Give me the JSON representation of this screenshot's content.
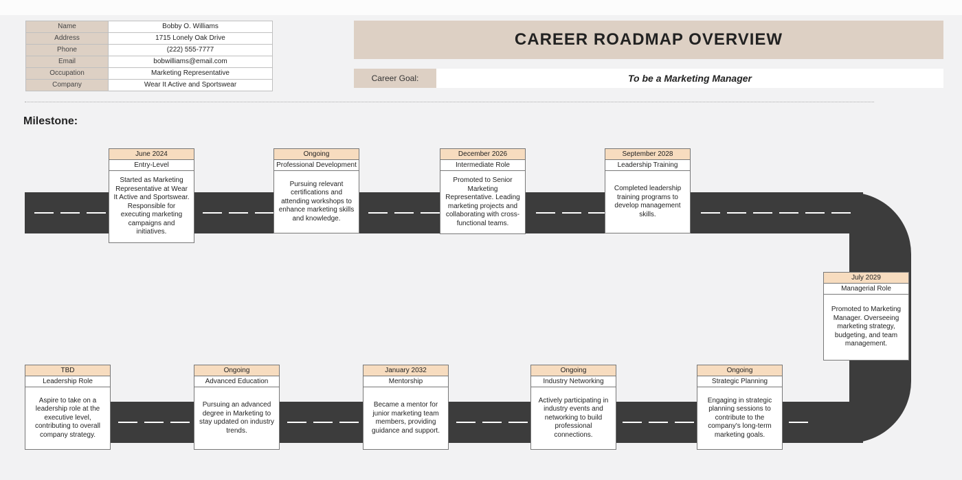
{
  "info": {
    "name_label": "Name",
    "name": "Bobby O. Williams",
    "address_label": "Address",
    "address": "1715 Lonely Oak Drive",
    "phone_label": "Phone",
    "phone": "(222) 555-7777",
    "email_label": "Email",
    "email": "bobwilliams@email.com",
    "occupation_label": "Occupation",
    "occupation": "Marketing Representative",
    "company_label": "Company",
    "company": "Wear It Active and Sportswear"
  },
  "title": "CAREER ROADMAP OVERVIEW",
  "goal_label": "Career Goal:",
  "goal_value": "To be a Marketing Manager",
  "milestone_header": "Milestone:",
  "milestones_top": [
    {
      "date": "June 2024",
      "cat": "Entry-Level",
      "body": "Started as Marketing Representative at Wear It Active and Sportswear. Responsible for executing marketing campaigns and initiatives."
    },
    {
      "date": "Ongoing",
      "cat": "Professional Development",
      "body": "Pursuing relevant certifications and attending workshops to enhance marketing skills and knowledge."
    },
    {
      "date": "December 2026",
      "cat": "Intermediate Role",
      "body": "Promoted to Senior Marketing Representative. Leading marketing projects and collaborating with cross-functional teams."
    },
    {
      "date": "September 2028",
      "cat": "Leadership Training",
      "body": "Completed leadership training programs to develop management skills."
    }
  ],
  "milestone_right": {
    "date": "July 2029",
    "cat": "Managerial Role",
    "body": "Promoted to Marketing Manager. Overseeing marketing strategy, budgeting, and team management."
  },
  "milestones_bottom": [
    {
      "date": "TBD",
      "cat": "Leadership Role",
      "body": "Aspire to take on a leadership role at the executive level, contributing to overall company strategy."
    },
    {
      "date": "Ongoing",
      "cat": "Advanced Education",
      "body": "Pursuing an advanced degree in Marketing to stay updated on industry trends."
    },
    {
      "date": "January 2032",
      "cat": "Mentorship",
      "body": "Became a mentor for junior marketing team members, providing guidance and support."
    },
    {
      "date": "Ongoing",
      "cat": "Industry Networking",
      "body": "Actively participating in industry events and networking to build professional connections."
    },
    {
      "date": "Ongoing",
      "cat": "Strategic Planning",
      "body": "Engaging in strategic planning sessions to contribute to the company's long-term marketing goals."
    }
  ]
}
